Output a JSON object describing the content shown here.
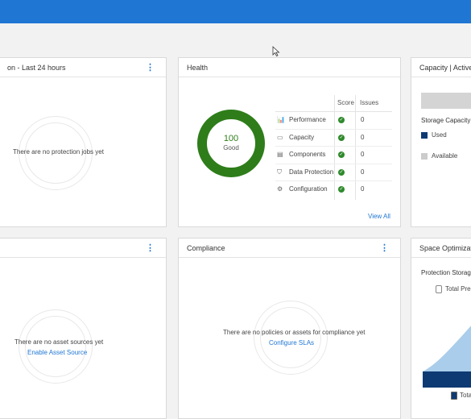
{
  "protection": {
    "title": "on - Last 24 hours",
    "empty": "There are no protection jobs yet"
  },
  "health": {
    "title": "Health",
    "score": "100",
    "status": "Good",
    "col_score": "Score",
    "col_issues": "Issues",
    "rows": [
      {
        "label": "Performance",
        "icon": "chart-icon",
        "issues": "0"
      },
      {
        "label": "Capacity",
        "icon": "cylinder-icon",
        "issues": "0"
      },
      {
        "label": "Components",
        "icon": "document-icon",
        "issues": "0"
      },
      {
        "label": "Data Protection",
        "icon": "shield-icon",
        "issues": "0"
      },
      {
        "label": "Configuration",
        "icon": "gear-icon",
        "issues": "0"
      }
    ],
    "view_all": "View All"
  },
  "capacity": {
    "title": "Capacity | Active",
    "storage_capacity": "Storage Capacity",
    "used": "Used",
    "available": "Available",
    "used_color": "#0e3a73",
    "available_color": "#cccccc"
  },
  "assets": {
    "empty": "There are no asset sources yet",
    "link": "Enable Asset Source"
  },
  "compliance": {
    "title": "Compliance",
    "empty": "There are no policies or assets for compliance yet",
    "link": "Configure SLAs"
  },
  "space": {
    "title": "Space Optimizat",
    "subtitle": "Protection Storage",
    "legend_top": "Total Pre-",
    "legend_bottom": "Total"
  }
}
